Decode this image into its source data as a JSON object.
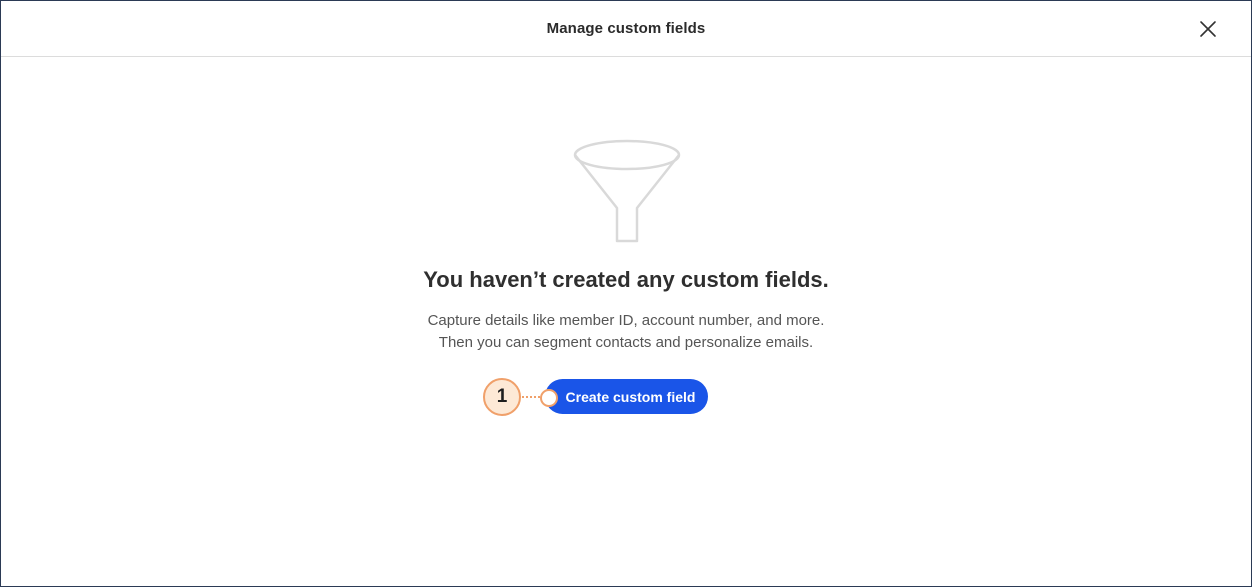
{
  "modal": {
    "title": "Manage custom fields",
    "close_icon": "close-icon"
  },
  "empty_state": {
    "icon": "funnel-icon",
    "heading": "You haven’t created any custom fields.",
    "description_line1": "Capture details like member ID, account number, and more.",
    "description_line2": "Then you can segment contacts and personalize emails.",
    "create_button_label": "Create custom field"
  },
  "callout": {
    "number": "1"
  },
  "colors": {
    "primary_button": "#1a55e8",
    "callout_accent": "#f0a06a",
    "callout_fill": "#fde9d6",
    "frame_border": "#2b3a55"
  }
}
